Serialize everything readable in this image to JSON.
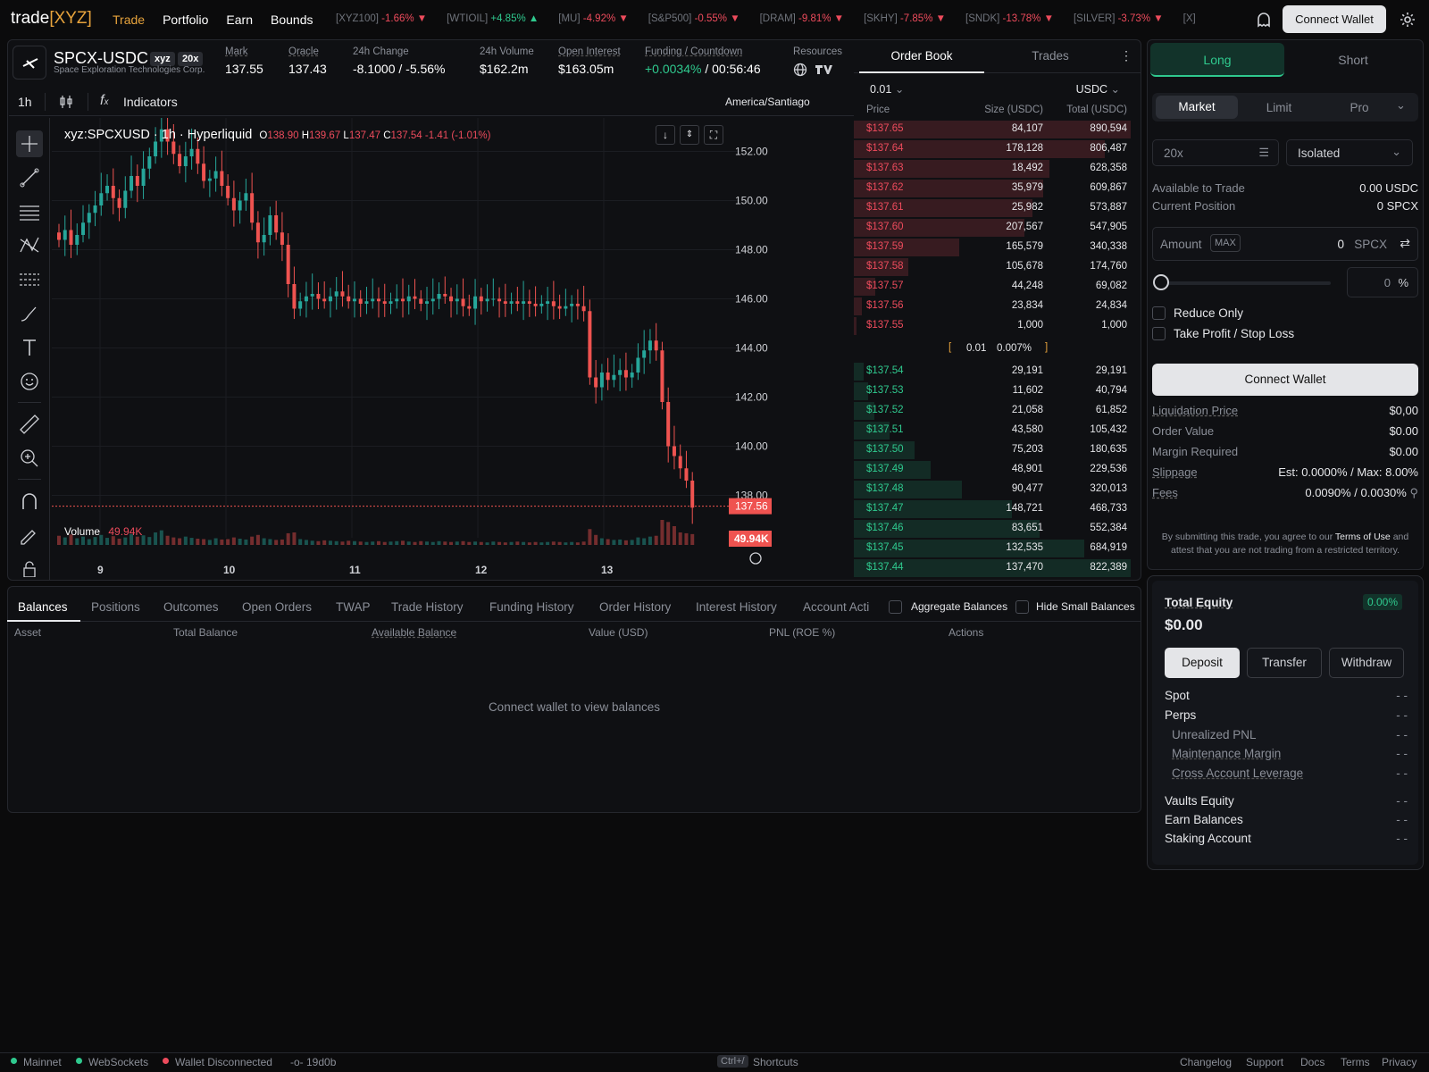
{
  "nav": {
    "logo_main": "trade",
    "logo_accent": "[XYZ]",
    "links": [
      "Trade",
      "Portfolio",
      "Earn",
      "Bounds"
    ],
    "active": "Trade",
    "connect_label": "Connect Wallet"
  },
  "ticker": [
    {
      "sym": "[XYZ100]",
      "chg": "-1.66%",
      "dir": "down"
    },
    {
      "sym": "[WTIOIL]",
      "chg": "+4.85%",
      "dir": "up"
    },
    {
      "sym": "[MU]",
      "chg": "-4.92%",
      "dir": "down"
    },
    {
      "sym": "[S&P500]",
      "chg": "-0.55%",
      "dir": "down"
    },
    {
      "sym": "[DRAM]",
      "chg": "-9.81%",
      "dir": "down"
    },
    {
      "sym": "[SKHY]",
      "chg": "-7.85%",
      "dir": "down"
    },
    {
      "sym": "[SNDK]",
      "chg": "-13.78%",
      "dir": "down"
    },
    {
      "sym": "[SILVER]",
      "chg": "-3.73%",
      "dir": "down"
    },
    {
      "sym": "[X]",
      "chg": "",
      "dir": "none"
    }
  ],
  "market": {
    "symbol": "SPCX-USDC",
    "badge_dex": "xyz",
    "badge_lev": "20x",
    "subtitle": "Space Exploration Technologies Corp.",
    "mark_label": "Mark",
    "mark": "137.55",
    "oracle_label": "Oracle",
    "oracle": "137.43",
    "change_label": "24h Change",
    "change": "-8.1000 / -5.56%",
    "volume_label": "24h Volume",
    "volume": "$162.2m",
    "oi_label": "Open Interest",
    "oi": "$163.05m",
    "funding_label": "Funding / Countdown",
    "funding": "+0.0034%",
    "countdown": "/ 00:56:46",
    "resources_label": "Resources"
  },
  "chart_toolbar": {
    "interval": "1h",
    "indicators": "Indicators",
    "timezone": "America/Santiago"
  },
  "chart_legend": {
    "title": "xyz:SPCXUSD · 1h · Hyperliquid",
    "o_label": "O",
    "o": "138.90",
    "h_label": "H",
    "h": "139.67",
    "l_label": "L",
    "l": "137.47",
    "c_label": "C",
    "c": "137.54",
    "chg": "-1.41 (-1.01%)",
    "volume_label": "Volume",
    "volume": "49.94K"
  },
  "chart_data": {
    "type": "candlestick",
    "y_ticks": [
      "152.00",
      "150.00",
      "148.00",
      "146.00",
      "144.00",
      "142.00",
      "140.00",
      "138.00"
    ],
    "ylim": [
      137.0,
      153.0
    ],
    "x_ticks": [
      "9",
      "10",
      "11",
      "12",
      "13"
    ],
    "last_price_label": "137.56",
    "last_volume_label": "49.94K",
    "colors": {
      "up": "#26a69a",
      "down": "#ef5350"
    },
    "close": [
      148.4,
      148.8,
      148.2,
      148.6,
      149.1,
      149.5,
      149.8,
      150.3,
      150.6,
      150.1,
      149.7,
      150.4,
      151.0,
      150.6,
      151.3,
      151.8,
      152.4,
      152.9,
      152.4,
      151.9,
      151.4,
      151.8,
      152.1,
      151.5,
      150.8,
      150.9,
      151.2,
      150.6,
      150.1,
      149.6,
      150.0,
      150.3,
      149.1,
      148.3,
      148.6,
      149.4,
      148.7,
      148.2,
      146.6,
      145.6,
      145.9,
      146.1,
      146.2,
      146.0,
      145.9,
      146.1,
      146.3,
      146.1,
      145.9,
      146.0,
      145.8,
      145.9,
      146.0,
      145.9,
      145.8,
      145.9,
      146.0,
      145.9,
      146.1,
      146.0,
      145.8,
      145.9,
      146.0,
      146.2,
      146.1,
      145.9,
      146.0,
      145.7,
      145.6,
      146.1,
      145.9,
      146.0,
      146.0,
      145.9,
      145.8,
      145.9,
      145.8,
      145.9,
      145.8,
      145.7,
      145.8,
      145.9,
      145.7,
      145.6,
      145.7,
      145.8,
      145.7,
      145.5,
      142.8,
      142.4,
      143.0,
      142.7,
      142.9,
      143.1,
      142.8,
      143.0,
      143.6,
      143.9,
      144.3,
      143.9,
      141.8,
      140.0,
      139.6,
      139.1,
      138.6,
      137.5
    ],
    "volume": [
      22,
      18,
      25,
      16,
      20,
      14,
      19,
      24,
      17,
      21,
      15,
      18,
      26,
      20,
      23,
      19,
      30,
      35,
      22,
      18,
      16,
      20,
      17,
      15,
      14,
      12,
      16,
      13,
      14,
      18,
      15,
      13,
      20,
      24,
      16,
      14,
      12,
      13,
      28,
      30,
      14,
      12,
      10,
      9,
      11,
      10,
      9,
      8,
      10,
      9,
      8,
      7,
      8,
      9,
      7,
      8,
      9,
      10,
      8,
      7,
      9,
      8,
      7,
      9,
      8,
      7,
      8,
      9,
      7,
      8,
      7,
      6,
      8,
      7,
      6,
      7,
      8,
      7,
      6,
      7,
      6,
      7,
      8,
      7,
      6,
      7,
      6,
      8,
      38,
      24,
      16,
      14,
      12,
      13,
      11,
      12,
      18,
      16,
      20,
      22,
      60,
      55,
      45,
      30,
      28,
      26
    ]
  },
  "orderbook": {
    "tab_book": "Order Book",
    "tab_trades": "Trades",
    "tick": "0.01",
    "unit": "USDC",
    "col_price": "Price",
    "col_size": "Size (USDC)",
    "col_total": "Total (USDC)",
    "asks": [
      {
        "p": "$137.65",
        "s": "84,107",
        "t": "890,594",
        "d": 1.0
      },
      {
        "p": "$137.64",
        "s": "178,128",
        "t": "806,487",
        "d": 0.906
      },
      {
        "p": "$137.63",
        "s": "18,492",
        "t": "628,358",
        "d": 0.706
      },
      {
        "p": "$137.62",
        "s": "35,979",
        "t": "609,867",
        "d": 0.685
      },
      {
        "p": "$137.61",
        "s": "25,982",
        "t": "573,887",
        "d": 0.644
      },
      {
        "p": "$137.60",
        "s": "207,567",
        "t": "547,905",
        "d": 0.615
      },
      {
        "p": "$137.59",
        "s": "165,579",
        "t": "340,338",
        "d": 0.382
      },
      {
        "p": "$137.58",
        "s": "105,678",
        "t": "174,760",
        "d": 0.196
      },
      {
        "p": "$137.57",
        "s": "44,248",
        "t": "69,082",
        "d": 0.078
      },
      {
        "p": "$137.56",
        "s": "23,834",
        "t": "24,834",
        "d": 0.028
      },
      {
        "p": "$137.55",
        "s": "1,000",
        "t": "1,000",
        "d": 0.001
      }
    ],
    "spread": "0.01",
    "spread_pct": "0.007%",
    "bids": [
      {
        "p": "$137.54",
        "s": "29,191",
        "t": "29,191",
        "d": 0.035
      },
      {
        "p": "$137.53",
        "s": "11,602",
        "t": "40,794",
        "d": 0.05
      },
      {
        "p": "$137.52",
        "s": "21,058",
        "t": "61,852",
        "d": 0.075
      },
      {
        "p": "$137.51",
        "s": "43,580",
        "t": "105,432",
        "d": 0.128
      },
      {
        "p": "$137.50",
        "s": "75,203",
        "t": "180,635",
        "d": 0.22
      },
      {
        "p": "$137.49",
        "s": "48,901",
        "t": "229,536",
        "d": 0.279
      },
      {
        "p": "$137.48",
        "s": "90,477",
        "t": "320,013",
        "d": 0.389
      },
      {
        "p": "$137.47",
        "s": "148,721",
        "t": "468,733",
        "d": 0.57
      },
      {
        "p": "$137.46",
        "s": "83,651",
        "t": "552,384",
        "d": 0.672
      },
      {
        "p": "$137.45",
        "s": "132,535",
        "t": "684,919",
        "d": 0.833
      },
      {
        "p": "$137.44",
        "s": "137,470",
        "t": "822,389",
        "d": 1.0
      }
    ]
  },
  "order": {
    "long": "Long",
    "short": "Short",
    "market": "Market",
    "limit": "Limit",
    "pro": "Pro",
    "leverage": "20x",
    "margin_mode": "Isolated",
    "avail_label": "Available to Trade",
    "avail": "0.00 USDC",
    "pos_label": "Current Position",
    "pos": "0 SPCX",
    "amount_label": "Amount",
    "max": "MAX",
    "amount": "0",
    "amount_unit": "SPCX",
    "pct": "0",
    "pct_unit": "%",
    "slider_fraction": 0,
    "reduce_only": "Reduce Only",
    "tpsl": "Take Profit / Stop Loss",
    "connect": "Connect Wallet",
    "liq_label": "Liquidation Price",
    "liq": "$0,00",
    "ov_label": "Order Value",
    "ov": "$0.00",
    "mr_label": "Margin Required",
    "mr": "$0.00",
    "slip_label": "Slippage",
    "slip": "Est: 0.0000% / Max: 8.00%",
    "fees_label": "Fees",
    "fees": "0.0090% / 0.0030%",
    "terms_pre": "By submitting this trade, you agree to our",
    "terms_link": "Terms of Use",
    "terms_post": "and attest that you are not trading from a restricted territory."
  },
  "bottom": {
    "tabs": [
      "Balances",
      "Positions",
      "Outcomes",
      "Open Orders",
      "TWAP",
      "Trade History",
      "Funding History",
      "Order History",
      "Interest History",
      "Account Acti"
    ],
    "active": "Balances",
    "aggregate": "Aggregate Balances",
    "hide_small": "Hide Small Balances",
    "cols": [
      "Asset",
      "Total Balance",
      "Available Balance",
      "Value (USD)",
      "PNL (ROE %)",
      "Actions"
    ],
    "empty": "Connect wallet to view balances"
  },
  "equity": {
    "title": "Total Equity",
    "pct": "0.00%",
    "value": "$0.00",
    "deposit": "Deposit",
    "transfer": "Transfer",
    "withdraw": "Withdraw",
    "rows": [
      {
        "k": "Spot",
        "v": "- -"
      },
      {
        "k": "Perps",
        "v": "- -"
      },
      {
        "k": "Unrealized PNL",
        "v": "- -"
      },
      {
        "k": "Maintenance Margin",
        "v": "- -"
      },
      {
        "k": "Cross Account Leverage",
        "v": "- -"
      },
      {
        "k": "Vaults Equity",
        "v": "- -"
      },
      {
        "k": "Earn Balances",
        "v": "- -"
      },
      {
        "k": "Staking Account",
        "v": "- -"
      }
    ]
  },
  "status": {
    "mainnet": "Mainnet",
    "ws": "WebSockets",
    "wallet": "Wallet Disconnected",
    "commit": "19d0b",
    "shortcut_key": "Ctrl+/",
    "shortcut_label": "Shortcuts",
    "links": [
      "Changelog",
      "Support",
      "Docs",
      "Terms",
      "Privacy"
    ]
  }
}
